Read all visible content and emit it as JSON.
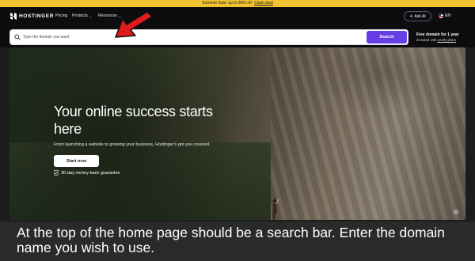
{
  "promo": {
    "text": "Summer Sale: up to 80% off",
    "link": "Claim deal"
  },
  "nav": {
    "brand": "HOSTINGER",
    "links": [
      {
        "label": "Pricing",
        "chevron": false
      },
      {
        "label": "Products",
        "chevron": true
      },
      {
        "label": "Resources",
        "chevron": true
      }
    ],
    "ask_ai": "Ask AI",
    "language": "EN"
  },
  "search": {
    "placeholder": "Type the domain you want",
    "button": "Search"
  },
  "free_domain": {
    "title": "Free domain for 1 year",
    "sub_prefix": "included with",
    "sub_link": "yearly plans"
  },
  "hero": {
    "title": "Your online success starts here",
    "subtitle": "From launching a website to growing your business, Hostinger's got you covered.",
    "cta": "Start now",
    "guarantee": "30-day money-back guarantee"
  },
  "caption": "At the top of the home page should be a search bar. Enter the domain name you wish to use.",
  "colors": {
    "accent": "#673de6",
    "promo": "#f2c230",
    "arrow": "#e01b1b"
  },
  "icons": [
    "hostinger-logo-icon",
    "search-icon",
    "sparkle-icon",
    "us-flag-icon",
    "shield-check-icon",
    "gear-icon",
    "red-arrow-icon"
  ]
}
